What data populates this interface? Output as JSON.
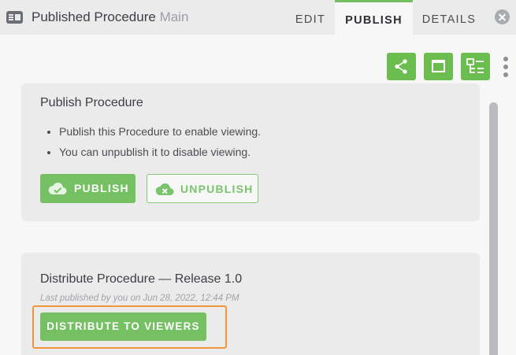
{
  "header": {
    "title": "Published Procedure",
    "subtitle": "Main",
    "tabs": [
      {
        "label": "EDIT",
        "active": false
      },
      {
        "label": "PUBLISH",
        "active": true
      },
      {
        "label": "DETAILS",
        "active": false
      }
    ]
  },
  "toolbar": {
    "icons": [
      "share-icon",
      "window-icon",
      "checklist-icon",
      "more-vertical-icon"
    ]
  },
  "publish_card": {
    "title": "Publish Procedure",
    "bullets": [
      "Publish this Procedure to enable viewing.",
      "You can unpublish it to disable viewing."
    ],
    "publish_label": "PUBLISH",
    "unpublish_label": "UNPUBLISH"
  },
  "distribute_card": {
    "title": "Distribute Procedure — Release 1.0",
    "last_published": "Last published by you on Jun 28, 2022, 12:44 PM",
    "distribute_label": "DISTRIBUTE TO VIEWERS"
  },
  "colors": {
    "accent_green": "#74c063",
    "highlight_orange": "#f0953a",
    "card_bg": "#ebebeb",
    "page_bg": "#f7f7f7"
  }
}
